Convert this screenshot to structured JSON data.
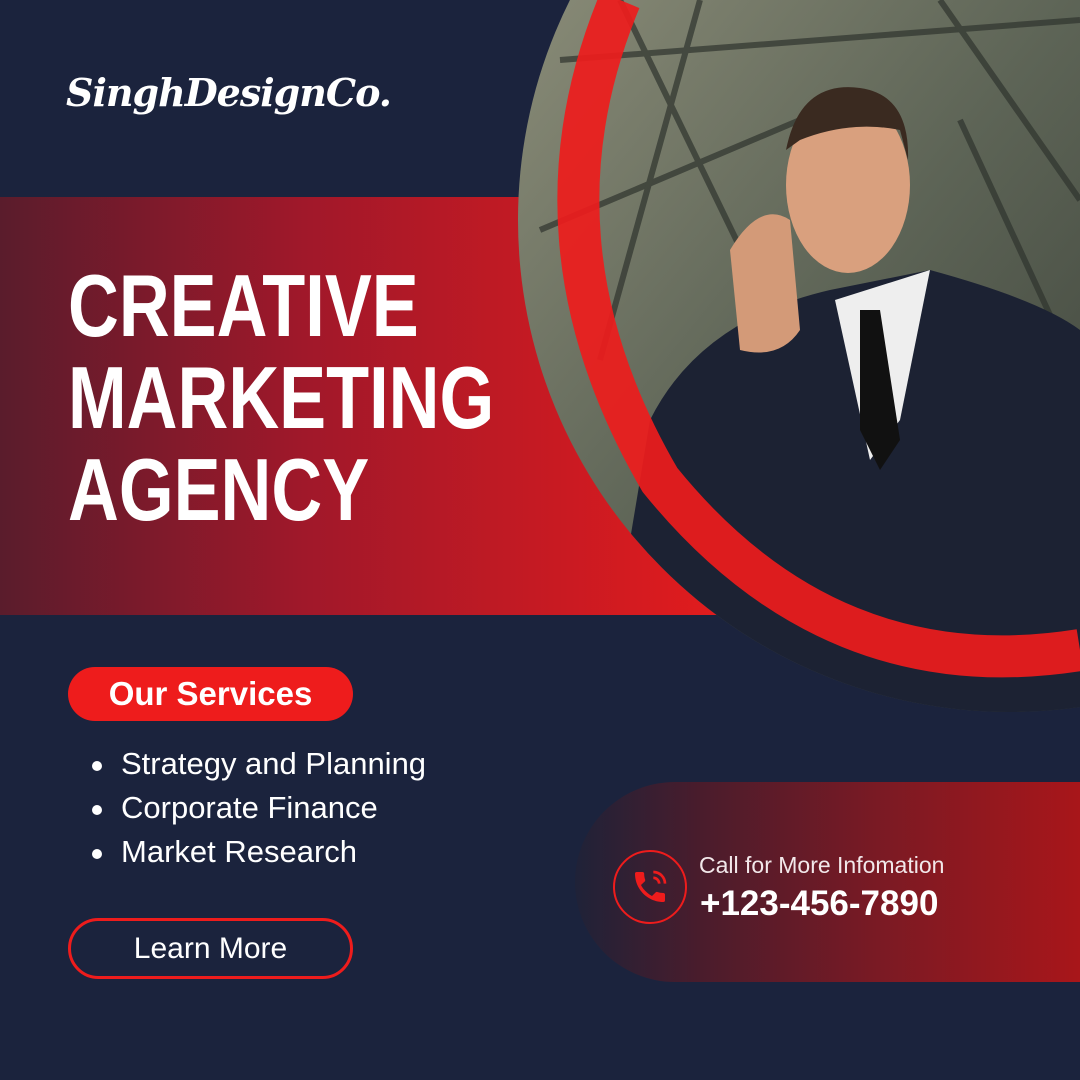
{
  "brand": {
    "logo": "SinghDesignCo."
  },
  "headline": {
    "line1": "CREATIVE",
    "line2": "MARKETING",
    "line3": "AGENCY"
  },
  "services": {
    "heading": "Our Services",
    "items": [
      "Strategy and Planning",
      "Corporate Finance",
      "Market Research"
    ]
  },
  "cta": {
    "learn_more": "Learn More"
  },
  "contact": {
    "label": "Call for More Infomation",
    "phone": "+123-456-7890",
    "icon": "phone-ringing-icon"
  },
  "colors": {
    "background": "#1b233d",
    "accent": "#ee1c1c"
  }
}
